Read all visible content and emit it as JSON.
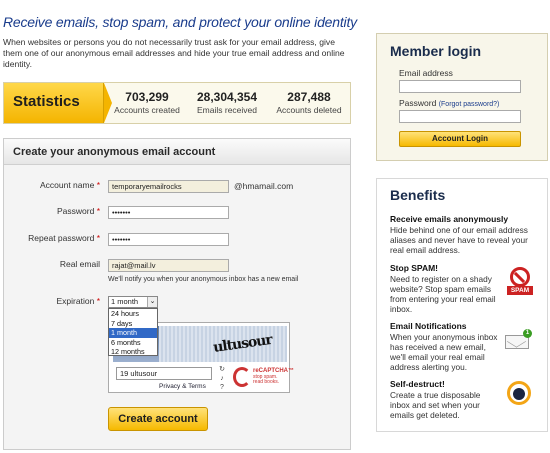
{
  "header": {
    "tagline": "Receive emails, stop spam, and protect your online identity",
    "intro": "When websites or persons you do not necessarily trust ask for your email address, give them one of our anonymous email addresses and hide your true email address and online identity."
  },
  "statistics": {
    "label": "Statistics",
    "items": [
      {
        "value": "703,299",
        "label": "Accounts created"
      },
      {
        "value": "28,304,354",
        "label": "Emails received"
      },
      {
        "value": "287,488",
        "label": "Accounts deleted"
      }
    ]
  },
  "create_form": {
    "title": "Create your anonymous email account",
    "account_name_label": "Account name",
    "account_name_value": "temporaryemailrocks",
    "domain": "@hmamail.com",
    "password_label": "Password",
    "password_value": "•••••••",
    "repeat_password_label": "Repeat password",
    "repeat_password_value": "•••••••",
    "real_email_label": "Real email",
    "real_email_value": "rajat@mail.lv",
    "note": "We'll notify you when your anonymous inbox has a new email",
    "expiration_label": "Expiration",
    "expiration_selected": "1 month",
    "expiration_options": [
      "24 hours",
      "7 days",
      "1 month",
      "6 months",
      "12 months"
    ],
    "expiration_highlight_index": 2,
    "captcha_word": "ultusour",
    "captcha_input_value": "19 ultusour",
    "captcha_links": "Privacy & Terms",
    "captcha_brand": "reCAPTCHA™",
    "captcha_brand_sub": "stop spam.\nread books.",
    "create_button": "Create account",
    "required_marker": "*"
  },
  "login": {
    "title": "Member login",
    "email_label": "Email address",
    "password_label": "Password",
    "forgot_link": "(Forgot password?)",
    "button": "Account Login"
  },
  "benefits": {
    "title": "Benefits",
    "items": [
      {
        "title": "Receive emails anonymously",
        "text": "Hide behind one of our email address aliases and never have to reveal your real email address."
      },
      {
        "title": "Stop SPAM!",
        "text": "Need to register on a shady website? Stop spam emails from entering your real email inbox."
      },
      {
        "title": "Email Notifications",
        "text": "When your anonymous inbox has received a new email, we'll email your real email address alerting you."
      },
      {
        "title": "Self-destruct!",
        "text": "Create a true disposable inbox and set when your emails get deleted."
      }
    ],
    "spam_icon_text": "SPAM",
    "mail_badge": "1"
  },
  "colors": {
    "accent_yellow": "#f6b900",
    "heading_blue": "#1a3c8c",
    "required_red": "#cc0000"
  }
}
